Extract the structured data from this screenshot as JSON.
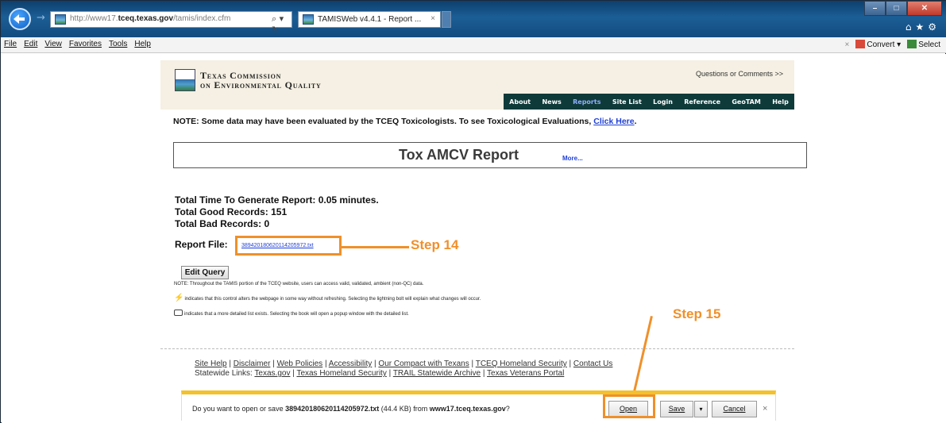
{
  "browser": {
    "url_prefix": "http://www17.",
    "url_domain": "tceq.texas.gov",
    "url_suffix": "/tamis/index.cfm",
    "addr_icons": "⌕ ▾ ↻",
    "tab_title": "TAMISWeb v4.4.1 - Report ...",
    "tab_close": "×",
    "forward_icon": "→",
    "min_label": "–",
    "max_label": "□",
    "close_label": "✕",
    "right_icons": "⌂★⚙"
  },
  "menu": {
    "items": [
      "File",
      "Edit",
      "View",
      "Favorites",
      "Tools",
      "Help"
    ],
    "close_x": "×",
    "convert": "Convert",
    "select": "Select",
    "caret": "▾"
  },
  "header": {
    "agency_line1": "Texas Commission",
    "agency_line2": "on Environmental Quality",
    "questions": "Questions or Comments >>",
    "nav": [
      "About",
      "News",
      "Reports",
      "Site List",
      "Login",
      "Reference",
      "GeoTAM",
      "Help"
    ],
    "active_nav": "Reports"
  },
  "note": {
    "text": "NOTE: Some data may have been evaluated by the TCEQ Toxicologists. To see Toxicological Evaluations, ",
    "link": "Click Here",
    "end": "."
  },
  "report": {
    "title": "Tox AMCV Report",
    "more": "More..."
  },
  "stats": {
    "time": "Total Time To Generate Report: 0.05 minutes.",
    "good": "Total Good Records: 151",
    "bad": "Total Bad Records: 0"
  },
  "report_file": {
    "label": "Report File:",
    "filename": "389420180620114205972.txt"
  },
  "annotations": {
    "step14": "Step 14",
    "step15": "Step 15",
    "accent": "#f0902a"
  },
  "edit_query": "Edit Query",
  "notes": {
    "line1": "NOTE: Throughout the TAMIS portion of the TCEQ website, users can access valid, validated, ambient (non-QC) data.",
    "line2": "indicates that this control alters the webpage in some way without refreshing. Selecting the lightning bolt will explain what changes will occur.",
    "line3": "indicates that a more detailed list exists. Selecting the book will open a popup window with the detailed list."
  },
  "footer": {
    "row1": [
      "Site Help",
      "Disclaimer",
      "Web Policies",
      "Accessibility",
      "Our Compact with Texans",
      "TCEQ Homeland Security",
      "Contact Us"
    ],
    "row2_label": "Statewide Links: ",
    "row2": [
      "Texas.gov",
      "Texas Homeland Security",
      "TRAIL Statewide Archive",
      "Texas Veterans Portal"
    ]
  },
  "download": {
    "prefix": "Do you want to open or save ",
    "filename": "389420180620114205972.txt",
    "size": " (44.4 KB) from ",
    "host": "www17.tceq.texas.gov",
    "suffix": "?",
    "open": "Open",
    "save": "Save",
    "save_caret": "▾",
    "cancel": "Cancel",
    "close": "×"
  }
}
